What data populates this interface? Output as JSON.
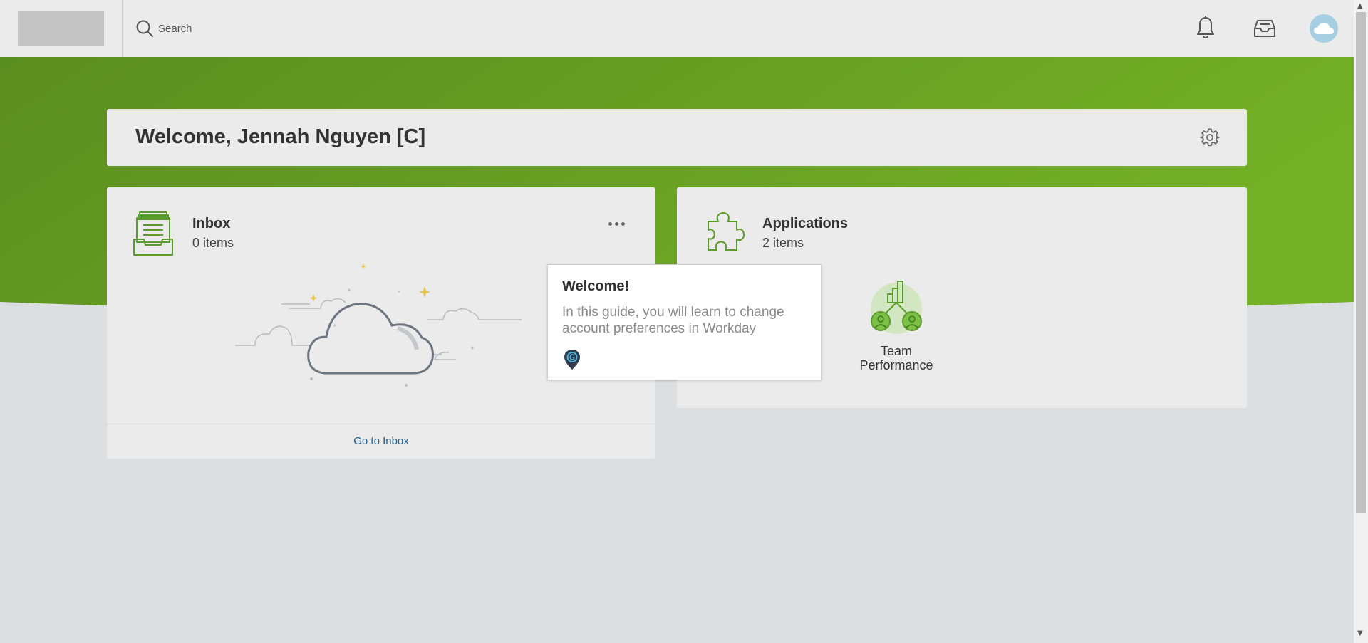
{
  "header": {
    "search_placeholder": "Search",
    "icons": [
      "search-icon",
      "bell-icon",
      "inbox-tray-icon",
      "cloud-avatar-icon"
    ]
  },
  "welcome": {
    "title": "Welcome, Jennah Nguyen [C]"
  },
  "inbox": {
    "title": "Inbox",
    "count": "0 items",
    "footer_link": "Go to Inbox"
  },
  "applications": {
    "title": "Applications",
    "count": "2 items",
    "items": [
      {
        "label": "Team Performance",
        "icon": "team-performance-icon"
      }
    ]
  },
  "guide": {
    "title": "Welcome!",
    "text": "In this guide, you will learn to change account preferences in Workday"
  },
  "colors": {
    "hero_green_dark": "#5a8d1f",
    "hero_green_light": "#74b126",
    "accent_green": "#5b9a2c",
    "link_blue": "#1f5e8c",
    "background": "#dcdfe2",
    "card": "#ebebeb"
  }
}
